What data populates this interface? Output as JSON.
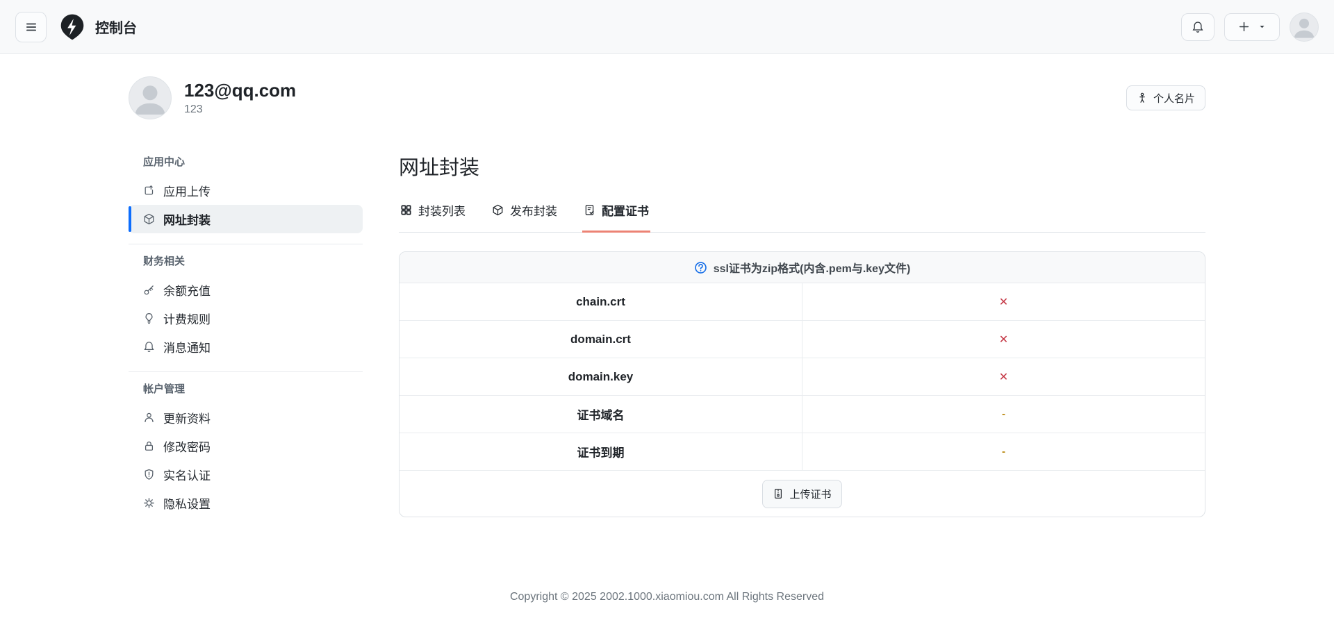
{
  "navbar": {
    "title": "控制台",
    "icons": {
      "menu": "hamburger-menu-icon",
      "logo": "lightning-pin-logo",
      "bell": "notification-bell-icon",
      "plus": "create-new-icon",
      "avatar": "user-avatar"
    }
  },
  "profile": {
    "email": "123@qq.com",
    "username": "123",
    "card_button_label": "个人名片"
  },
  "sidebar": {
    "sections": [
      {
        "header": "应用中心",
        "items": [
          {
            "label": "应用上传",
            "icon": "box-arrow-up-icon",
            "active": false
          },
          {
            "label": "网址封装",
            "icon": "cube-icon",
            "active": true
          }
        ]
      },
      {
        "header": "财务相关",
        "items": [
          {
            "label": "余额充值",
            "icon": "key-icon",
            "active": false
          },
          {
            "label": "计费规则",
            "icon": "lightbulb-icon",
            "active": false
          },
          {
            "label": "消息通知",
            "icon": "bell-icon",
            "active": false
          }
        ]
      },
      {
        "header": "帐户管理",
        "items": [
          {
            "label": "更新资料",
            "icon": "person-icon",
            "active": false
          },
          {
            "label": "修改密码",
            "icon": "lock-icon",
            "active": false
          },
          {
            "label": "实名认证",
            "icon": "shield-exclamation-icon",
            "active": false
          },
          {
            "label": "隐私设置",
            "icon": "gear-icon",
            "active": false
          }
        ]
      }
    ]
  },
  "main": {
    "title": "网址封装",
    "tabs": [
      {
        "label": "封装列表",
        "icon": "grid-icon",
        "active": false
      },
      {
        "label": "发布封装",
        "icon": "cube-icon",
        "active": false
      },
      {
        "label": "配置证书",
        "icon": "file-check-icon",
        "active": true
      }
    ],
    "certificate": {
      "notice": "ssl证书为zip格式(内含.pem与.key文件)",
      "rows": [
        {
          "name": "chain.crt",
          "status": "✕",
          "status_type": "missing"
        },
        {
          "name": "domain.crt",
          "status": "✕",
          "status_type": "missing"
        },
        {
          "name": "domain.key",
          "status": "✕",
          "status_type": "missing"
        },
        {
          "name": "证书域名",
          "status": "-",
          "status_type": "empty"
        },
        {
          "name": "证书到期",
          "status": "-",
          "status_type": "empty"
        }
      ],
      "upload_button_label": "上传证书"
    }
  },
  "footer": {
    "copyright": "Copyright © 2025 2002.1000.xiaomiou.com All Rights Reserved"
  },
  "colors": {
    "navbar_bg": "#f8f9fa",
    "accent_blue": "#176fe8",
    "sidebar_active_bar": "#0d6efd",
    "tab_underline": "#ec8374",
    "status_missing": "#c43543",
    "status_empty": "#b8860b"
  }
}
